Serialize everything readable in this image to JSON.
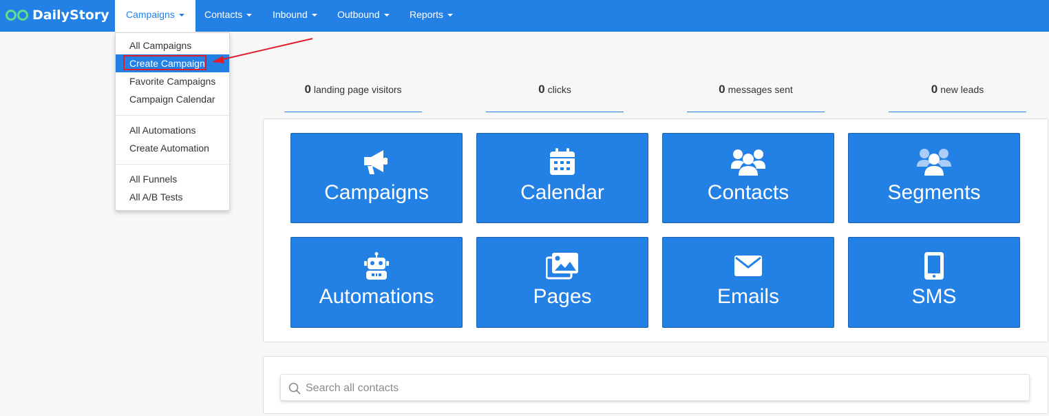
{
  "brand": {
    "name": "DailyStory",
    "color": "#2380e5"
  },
  "nav": {
    "campaigns": "Campaigns",
    "contacts": "Contacts",
    "inbound": "Inbound",
    "outbound": "Outbound",
    "reports": "Reports"
  },
  "dropdown": {
    "items": [
      "All Campaigns",
      "Create Campaign",
      "Favorite Campaigns",
      "Campaign Calendar",
      "All Automations",
      "Create Automation",
      "All Funnels",
      "All A/B Tests"
    ],
    "active_index": 1,
    "highlight_color": "#e11d2a"
  },
  "stats": [
    {
      "value": "0",
      "label": "landing page visitors"
    },
    {
      "value": "0",
      "label": "clicks"
    },
    {
      "value": "0",
      "label": "messages sent"
    },
    {
      "value": "0",
      "label": "new leads"
    }
  ],
  "tiles": [
    {
      "label": "Campaigns",
      "icon": "megaphone-icon"
    },
    {
      "label": "Calendar",
      "icon": "calendar-icon"
    },
    {
      "label": "Contacts",
      "icon": "users-icon"
    },
    {
      "label": "Segments",
      "icon": "user-group-icon"
    },
    {
      "label": "Automations",
      "icon": "robot-icon"
    },
    {
      "label": "Pages",
      "icon": "images-icon"
    },
    {
      "label": "Emails",
      "icon": "envelope-icon"
    },
    {
      "label": "SMS",
      "icon": "mobile-icon"
    }
  ],
  "search": {
    "placeholder": "Search all contacts",
    "value": ""
  }
}
